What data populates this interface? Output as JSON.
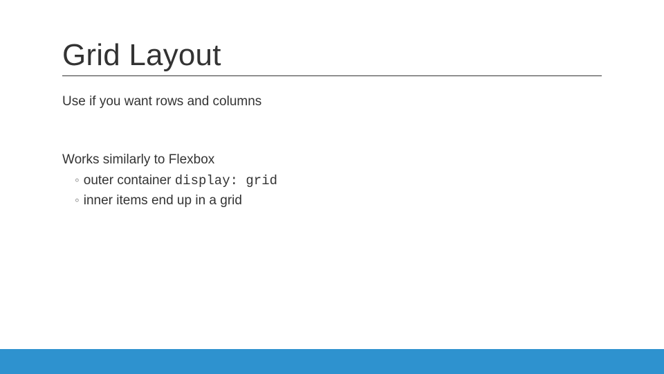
{
  "slide": {
    "title": "Grid Layout",
    "para1": "Use if you want rows and columns",
    "para2": "Works similarly to Flexbox",
    "sub1_prefix": "outer container ",
    "sub1_code": "display: grid",
    "sub2": "inner items end up in a grid",
    "bullet_glyph": "◦",
    "bar_color": "#2e92cf"
  }
}
